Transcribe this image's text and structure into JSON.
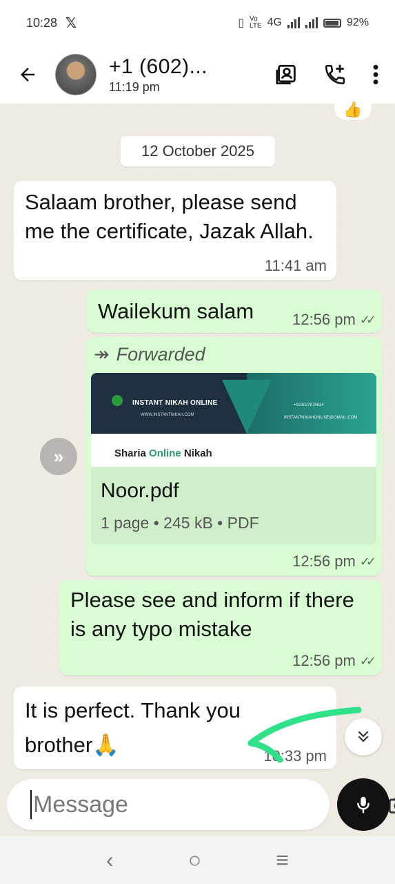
{
  "status_bar": {
    "time": "10:28",
    "app_icon": "x-logo",
    "network": "4G",
    "volte": "VoLTE",
    "battery": "92%"
  },
  "header": {
    "contact_name": "+1 (602)...",
    "subtitle": "11:19 pm",
    "icons": [
      "back-arrow-icon",
      "contact-card-icon",
      "add-call-icon",
      "more-vert-icon"
    ]
  },
  "chat": {
    "date_separator": "12 October 2025",
    "messages": [
      {
        "dir": "in",
        "text": "Salaam brother, please send me the certificate, Jazak Allah.",
        "time": "11:41 am"
      },
      {
        "dir": "out",
        "text": "Wailekum salam",
        "time": "12:56 pm"
      },
      {
        "dir": "out",
        "forwarded_label": "Forwarded",
        "document": {
          "name": "Noor.pdf",
          "meta": "1 page • 245 kB • PDF",
          "thumb_brand": "INSTANT NIKAH ONLINE",
          "thumb_web": "WWW.INSTANTNIKAH.COM",
          "thumb_phone": "+923027878634",
          "thumb_email": "INSTANTNIKAHONLINE@GMAIL.COM",
          "thumb_caption_a": "Sharia ",
          "thumb_caption_b": "Online",
          "thumb_caption_c": " Nikah"
        },
        "time": "12:56 pm"
      },
      {
        "dir": "out",
        "text": "Please see and inform if there is any typo mistake",
        "time": "12:56 pm"
      },
      {
        "dir": "in",
        "text": "It is perfect. Thank you brother🙏",
        "time": "10:33 pm"
      }
    ]
  },
  "composer": {
    "placeholder": "Message",
    "value": ""
  },
  "annotation_color": "#2fe28a",
  "theme": {
    "outgoing": "#d9fdd3",
    "incoming": "#ffffff",
    "wallpaper": "#efeae2"
  }
}
